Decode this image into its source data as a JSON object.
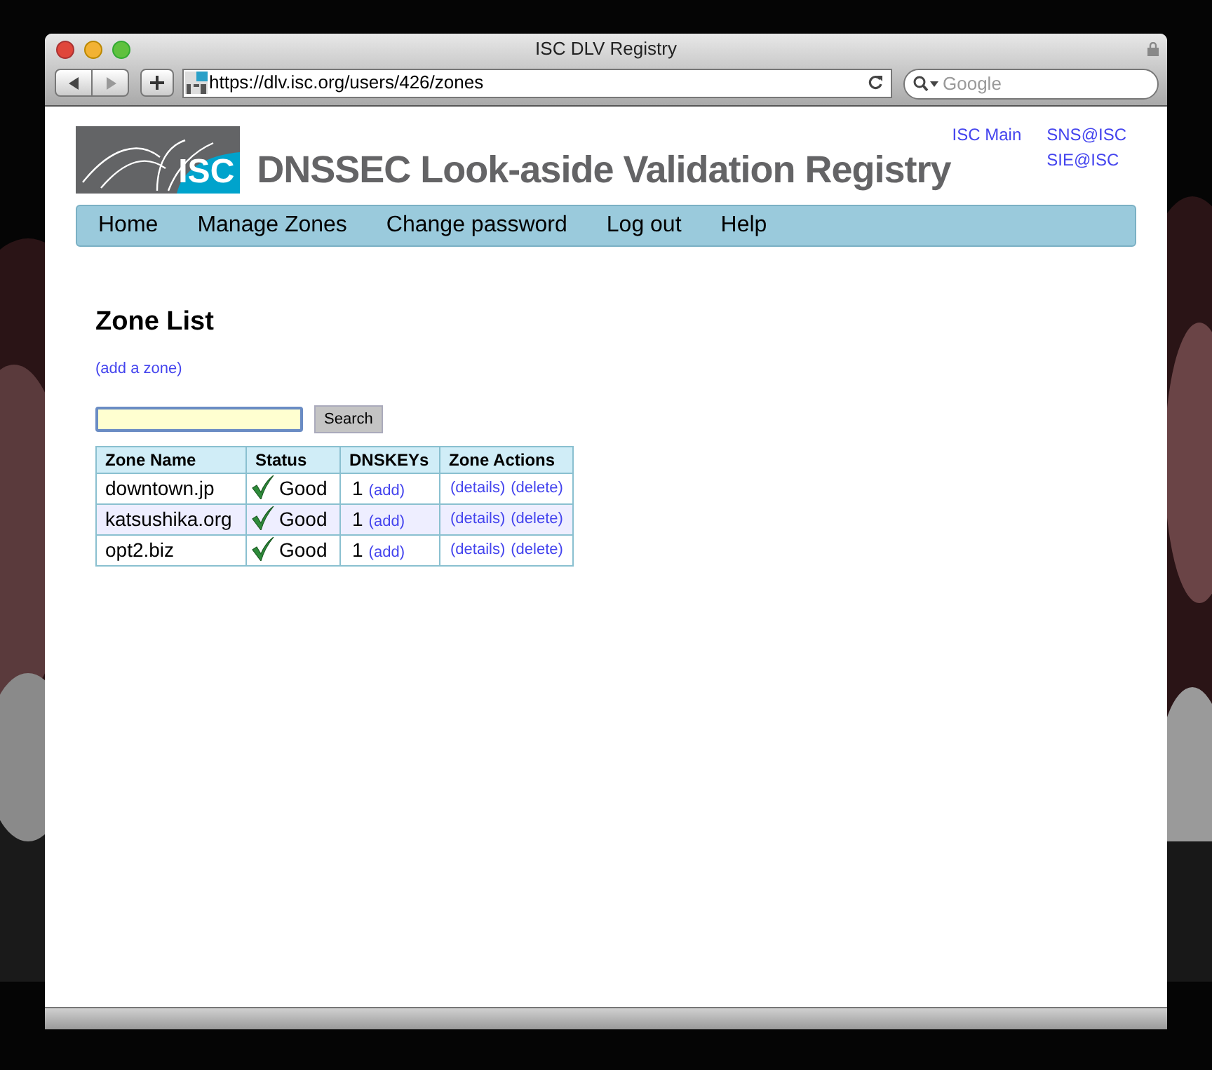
{
  "window": {
    "title": "ISC DLV Registry"
  },
  "address_bar": {
    "url": "https://dlv.isc.org/users/426/zones"
  },
  "search_box": {
    "placeholder": "Google"
  },
  "header": {
    "logo_text": "ISC",
    "title": "DNSSEC Look-aside Validation Registry",
    "links": [
      "ISC Main",
      "SNS@ISC",
      "SIE@ISC"
    ]
  },
  "nav": [
    "Home",
    "Manage Zones",
    "Change password",
    "Log out",
    "Help"
  ],
  "page": {
    "heading": "Zone List",
    "add_link": "(add a zone)",
    "search_button": "Search"
  },
  "table": {
    "columns": [
      "Zone Name",
      "Status",
      "DNSKEYs",
      "Zone Actions"
    ],
    "rows": [
      {
        "zone": "downtown.jp",
        "status": "Good",
        "kind": "good",
        "dnskeys": "1",
        "add": "(add)",
        "actions": [
          "(details)",
          "(delete)"
        ]
      },
      {
        "zone": "katsushika.org",
        "status": "Good",
        "kind": "good",
        "dnskeys": "1",
        "add": "(add)",
        "actions": [
          "(details)",
          "(delete)"
        ]
      },
      {
        "zone": "opt2.biz",
        "status": "Good",
        "kind": "good",
        "dnskeys": "1",
        "add": "(add)",
        "actions": [
          "(details)",
          "(delete)"
        ]
      }
    ]
  }
}
